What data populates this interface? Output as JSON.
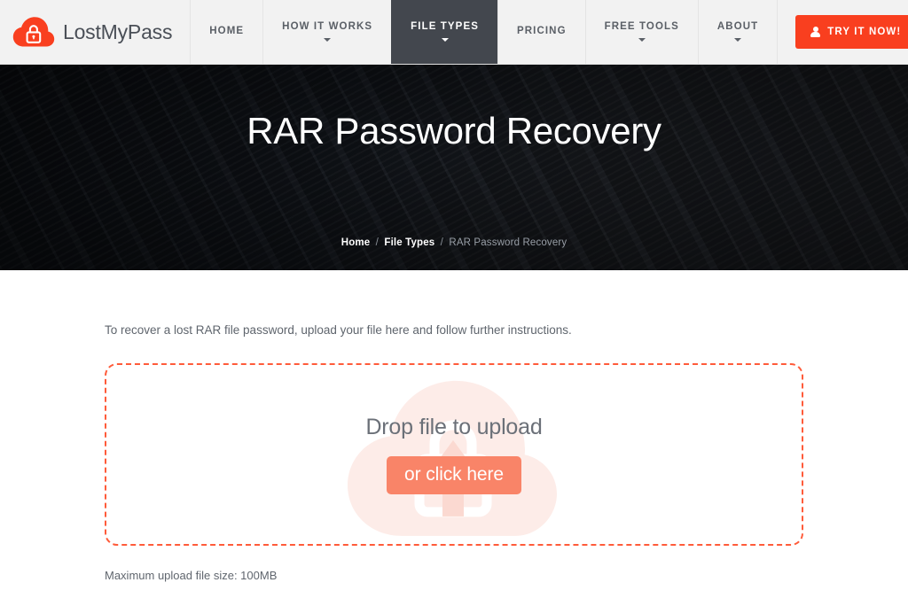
{
  "header": {
    "brand": {
      "name": "LostMyPass",
      "logo_icon": "cloud-lock-icon"
    },
    "nav": [
      {
        "label": "HOME",
        "has_caret": false,
        "active": false
      },
      {
        "label": "HOW IT WORKS",
        "has_caret": true,
        "active": false
      },
      {
        "label": "FILE TYPES",
        "has_caret": true,
        "active": true
      },
      {
        "label": "PRICING",
        "has_caret": false,
        "active": false
      },
      {
        "label": "FREE TOOLS",
        "has_caret": true,
        "active": false
      },
      {
        "label": "ABOUT",
        "has_caret": true,
        "active": false
      }
    ],
    "cta": {
      "label": "TRY IT NOW!",
      "icon": "user-icon"
    }
  },
  "hero": {
    "title": "RAR Password Recovery",
    "breadcrumb": {
      "home": "Home",
      "section": "File Types",
      "current": "RAR Password Recovery",
      "separator": "/"
    }
  },
  "main": {
    "intro": "To recover a lost RAR file password, upload your file here and follow further instructions.",
    "dropzone": {
      "drop_text": "Drop file to upload",
      "button_label": "or click here",
      "watermark_icon": "cloud-lock-watermark"
    },
    "max_size": "Maximum upload file size: 100MB"
  },
  "colors": {
    "brand_orange": "#f93f1f",
    "dropzone_border": "#ff5b3a",
    "dropzone_button": "#f98468",
    "nav_active_bg": "#43474e",
    "header_bg": "#f2f2f2",
    "hero_bg": "#1b1f26"
  }
}
